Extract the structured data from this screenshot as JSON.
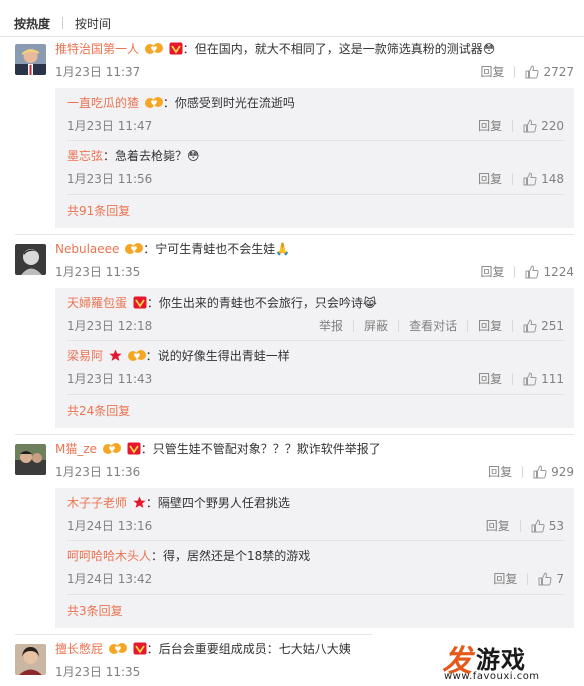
{
  "sort": {
    "hot": "按热度",
    "time": "按时间"
  },
  "comments": [
    {
      "user": "推特治国第一人",
      "text": "但在国内，就大不相同了，这是一款筛选真粉的测试器",
      "emoji": "😳",
      "date": "1月23日 11:37",
      "reply_label": "回复",
      "likes": "2727",
      "replies": [
        {
          "user": "一直吃瓜的猹",
          "text": "你感受到时光在流逝吗",
          "date": "1月23日 11:47",
          "reply_label": "回复",
          "likes": "220"
        },
        {
          "user": "墨忘弦",
          "text": "急着去枪毙？",
          "emoji": "😳",
          "date": "1月23日 11:56",
          "reply_label": "回复",
          "likes": "148"
        }
      ],
      "more": "共91条回复"
    },
    {
      "user": "Nebulaeee",
      "text": "宁可生青蛙也不会生娃",
      "emoji": "🙏",
      "date": "1月23日 11:35",
      "reply_label": "回复",
      "likes": "1224",
      "replies": [
        {
          "user": "天婦羅包蛋",
          "text": "你生出来的青蛙也不会旅行，只会吟诗",
          "emoji": "😹",
          "date": "1月23日 12:18",
          "report_label": "举报",
          "block_label": "屏蔽",
          "view_label": "查看对话",
          "reply_label": "回复",
          "likes": "251"
        },
        {
          "user": "梁易阿",
          "text": "说的好像生得出青蛙一样",
          "date": "1月23日 11:43",
          "reply_label": "回复",
          "likes": "111"
        }
      ],
      "more": "共24条回复"
    },
    {
      "user": "M猫_ze",
      "text": "只管生娃不管配对象？？？欺诈软件举报了",
      "date": "1月23日 11:36",
      "reply_label": "回复",
      "likes": "929",
      "replies": [
        {
          "user": "木子子老师",
          "text": "隔壁四个野男人任君挑选",
          "date": "1月24日 13:16",
          "reply_label": "回复",
          "likes": "53"
        },
        {
          "user": "呵呵哈哈木头人",
          "text": "得，居然还是个18禁的游戏",
          "date": "1月24日 13:42",
          "reply_label": "回复",
          "likes": "7"
        }
      ],
      "more": "共3条回复"
    },
    {
      "user": "擅长憋屁",
      "text": "后台会重要组成成员：七大姑八大姨",
      "date": "1月23日 11:35"
    }
  ],
  "watermark": {
    "mark": "发",
    "title": "游戏",
    "url": "www.favouxi.com"
  },
  "colors": {
    "username": "#eb7350",
    "meta": "#808080",
    "reply_bg": "#f2f2f5",
    "badge_red": "#e6162d",
    "badge_gold": "#f5a623"
  },
  "icons": {
    "like": "thumbs-up-icon",
    "vip": "vip-badge-icon",
    "fan": "fan-badge-icon",
    "star": "star-badge-icon"
  }
}
